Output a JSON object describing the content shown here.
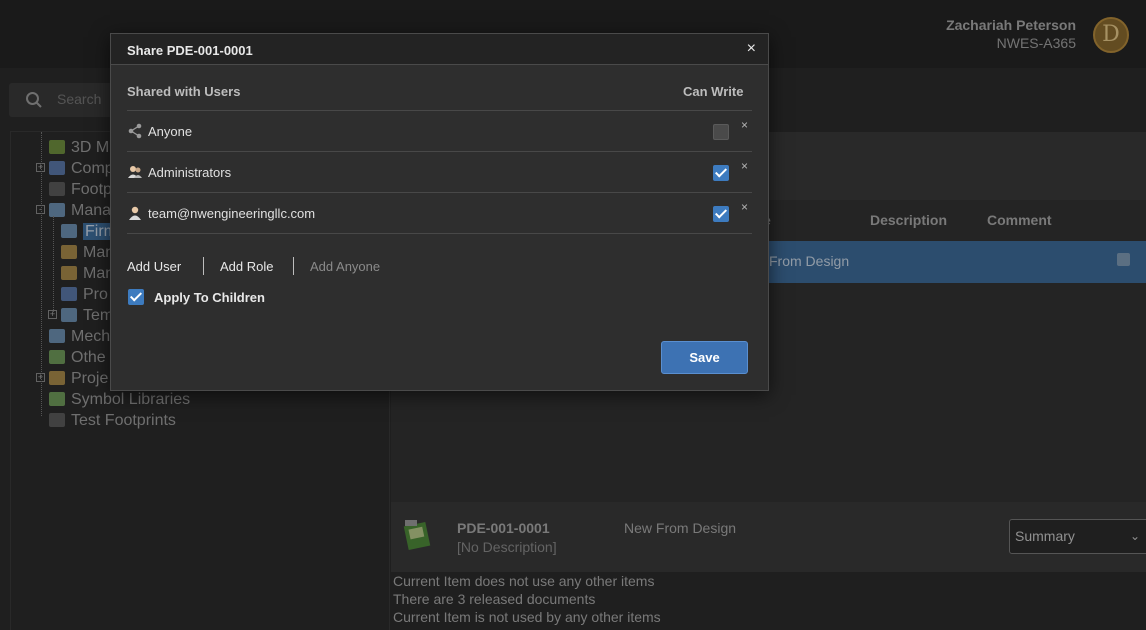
{
  "header": {
    "user_name": "Zachariah Peterson",
    "workspace": "NWES-A365",
    "avatar_letter": "D"
  },
  "left_panel": {
    "search_placeholder": "Search",
    "tree": [
      {
        "label": "3D M",
        "icon": "3d-model-icon",
        "expand": ""
      },
      {
        "label": "Comp",
        "icon": "component-icon",
        "expand": "+"
      },
      {
        "label": "Footp",
        "icon": "footprint-icon",
        "expand": ""
      },
      {
        "label": "Mana",
        "icon": "folder-icon",
        "expand": "-"
      },
      {
        "label": "Firm",
        "icon": "folder-icon",
        "expand": "",
        "selected": true
      },
      {
        "label": "Man",
        "icon": "document-icon",
        "expand": ""
      },
      {
        "label": "Man",
        "icon": "document-icon",
        "expand": ""
      },
      {
        "label": "Pro",
        "icon": "component-icon",
        "expand": ""
      },
      {
        "label": "Tem",
        "icon": "folder-icon",
        "expand": "+"
      },
      {
        "label": "Mech",
        "icon": "folder-icon",
        "expand": ""
      },
      {
        "label": "Othe",
        "icon": "library-icon",
        "expand": ""
      },
      {
        "label": "Proje",
        "icon": "project-icon",
        "expand": "+"
      },
      {
        "label": "Symbol Libraries",
        "icon": "library-icon",
        "expand": ""
      },
      {
        "label": "Test Footprints",
        "icon": "footprint-icon",
        "expand": ""
      }
    ]
  },
  "grid": {
    "col_partial": "e",
    "col_description": "Description",
    "col_comment": "Comment",
    "selected_row_text": "From Design"
  },
  "detail": {
    "item_number": "PDE-001-0001",
    "item_description": "[No Description]",
    "item_name": "New From Design",
    "view_select_value": "Summary",
    "info_lines": [
      "Current Item does not use any other items",
      "There are 3 released documents",
      "Current Item is not used by any other items"
    ]
  },
  "dialog": {
    "title": "Share PDE-001-0001",
    "close_glyph": "×",
    "header_users": "Shared with Users",
    "header_can_write": "Can Write",
    "rows": [
      {
        "name": "Anyone",
        "icon": "share-icon",
        "can_write": false,
        "remove_glyph": "×"
      },
      {
        "name": "Administrators",
        "icon": "group-icon",
        "can_write": true,
        "remove_glyph": "×"
      },
      {
        "name": "team@nwengineeringllc.com",
        "icon": "user-icon",
        "can_write": true,
        "remove_glyph": "×"
      }
    ],
    "actions": {
      "add_user": "Add User",
      "add_role": "Add Role",
      "add_anyone": "Add Anyone"
    },
    "apply_to_children": {
      "label": "Apply To Children",
      "checked": true
    },
    "save_label": "Save"
  },
  "colors": {
    "accent": "#3d72b3",
    "checkbox_on": "#3d7bbf",
    "selection_row": "#3e6b99"
  }
}
